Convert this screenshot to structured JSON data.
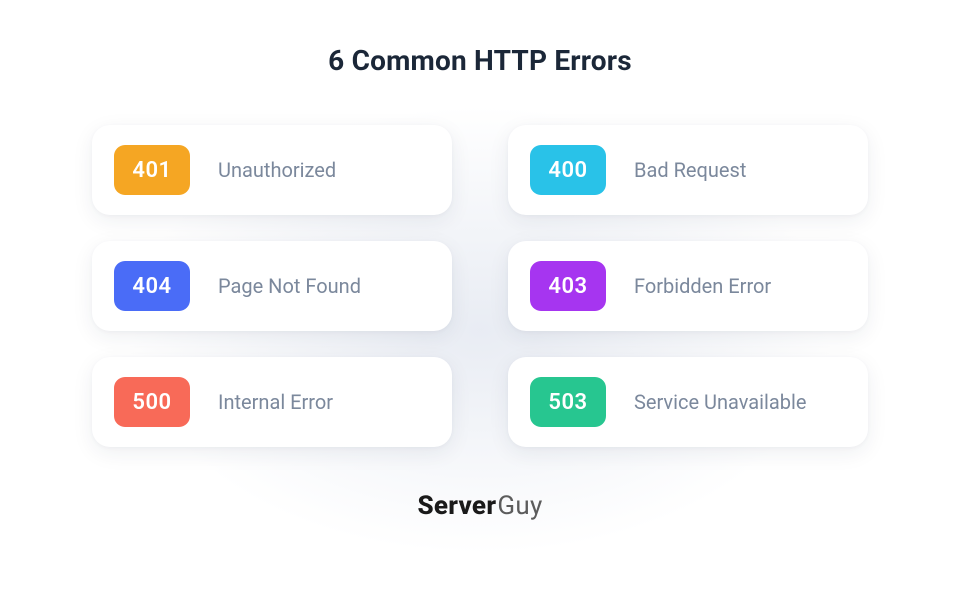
{
  "title": "6 Common HTTP Errors",
  "errors": [
    {
      "code": "401",
      "name": "Unauthorized",
      "color": "#F5A623"
    },
    {
      "code": "400",
      "name": "Bad Request",
      "color": "#29C2E8"
    },
    {
      "code": "404",
      "name": "Page Not Found",
      "color": "#4A6CF7"
    },
    {
      "code": "403",
      "name": "Forbidden Error",
      "color": "#A635F0"
    },
    {
      "code": "500",
      "name": "Internal Error",
      "color": "#F86A58"
    },
    {
      "code": "503",
      "name": "Service Unavailable",
      "color": "#27C690"
    }
  ],
  "brand": {
    "strong": "Server",
    "light": "Guy"
  }
}
